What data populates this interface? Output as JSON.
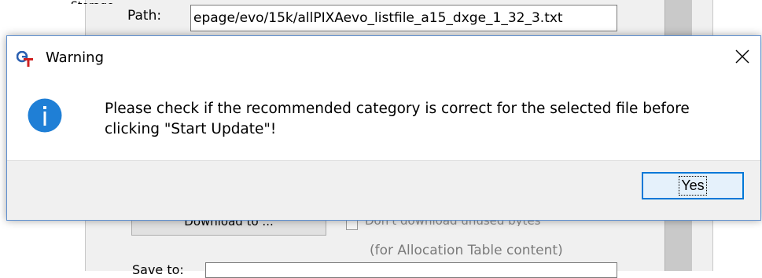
{
  "background_window": {
    "top_cut_text": "Storage",
    "path_label": "Path:",
    "path_value": "epage/evo/15k/allPIXAevo_listfile_a15_dxge_1_32_3.txt",
    "button_label": "Download to ...",
    "checkbox_label": "Don't download unused bytes",
    "allocation_note": "(for Allocation Table content)",
    "bottom_label": "Save to:"
  },
  "dialog": {
    "title": "Warning",
    "icon": "info-icon",
    "message_line1": "Please check if the recommended category is correct for the selected file before",
    "message_line2": "clicking \"Start Update\"!",
    "yes_label": "Yes",
    "close_icon": "close-icon",
    "accent_color": "#0078d7"
  }
}
